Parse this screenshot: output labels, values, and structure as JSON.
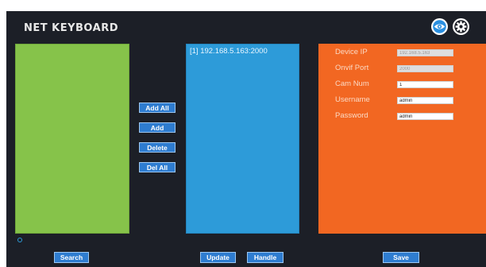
{
  "app": {
    "title": "NET KEYBOARD"
  },
  "header": {
    "eye_icon": "eye-icon",
    "gear_icon": "gear-icon"
  },
  "device_list": {
    "items": [
      "[1] 192.168.5.163:2000"
    ]
  },
  "actions": {
    "add_all": "Add All",
    "add": "Add",
    "delete": "Delete",
    "del_all": "Del All"
  },
  "device_form": {
    "device_ip_label": "Device IP",
    "device_ip_value": "192.168.5.163",
    "onvif_port_label": "Onvif Port",
    "onvif_port_value": "2000",
    "cam_num_label": "Cam Num",
    "cam_num_value": "1",
    "username_label": "Username",
    "username_value": "admin",
    "password_label": "Password",
    "password_value": "admin"
  },
  "footer": {
    "search": "Search",
    "update": "Update",
    "handle": "Handle",
    "save": "Save"
  },
  "colors": {
    "background": "#1c1f27",
    "search_panel": "#86c34a",
    "device_panel": "#2d9bd9",
    "form_panel": "#f26722",
    "button": "#2e7cd0"
  }
}
